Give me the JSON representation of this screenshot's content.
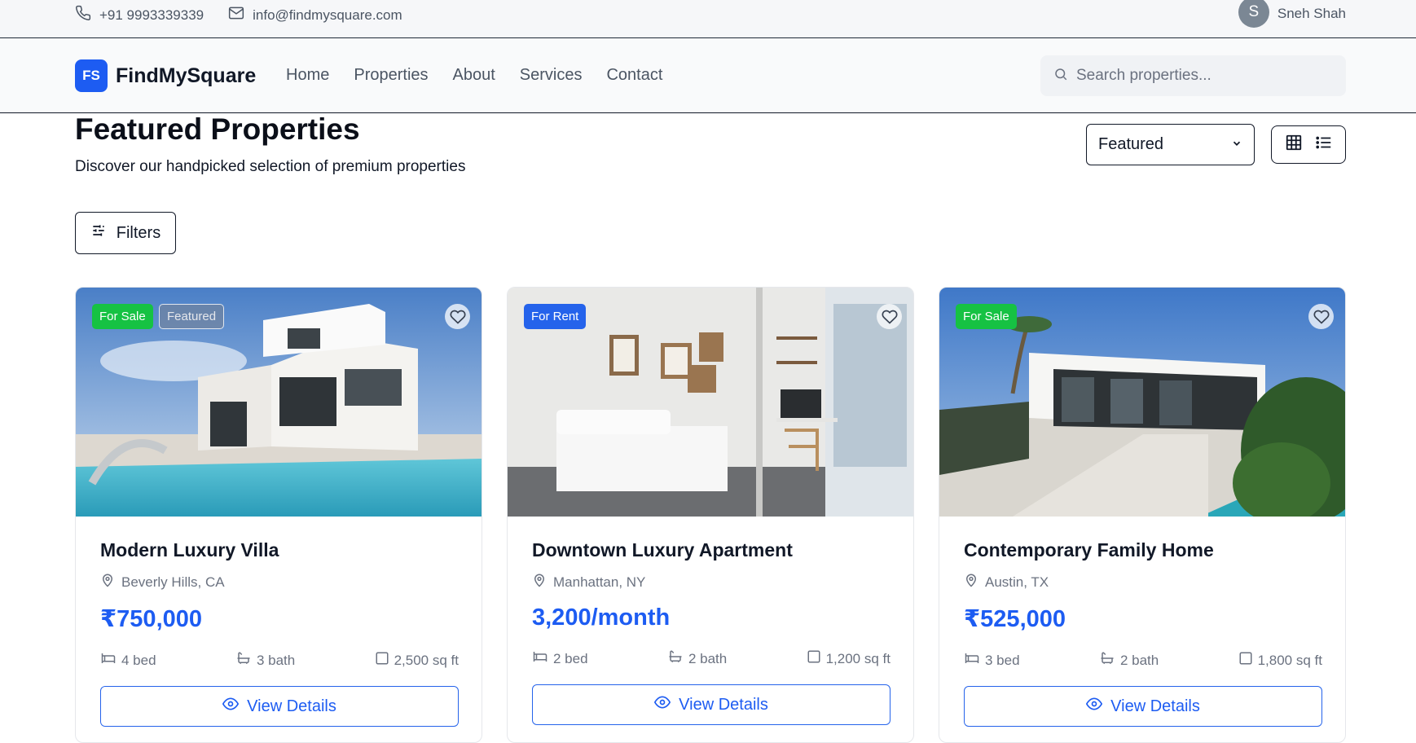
{
  "topbar": {
    "phone": "+91 9993339339",
    "email": "info@findmysquare.com",
    "user_initial": "S",
    "user_name": "Sneh Shah"
  },
  "brand": {
    "logo_text": "FS",
    "name": "FindMySquare"
  },
  "nav": {
    "items": [
      "Home",
      "Properties",
      "About",
      "Services",
      "Contact"
    ]
  },
  "search": {
    "placeholder": "Search properties..."
  },
  "page": {
    "title": "Featured Properties",
    "subtitle": "Discover our handpicked selection of premium properties",
    "sort_value": "Featured",
    "filters_label": "Filters"
  },
  "colors": {
    "accent": "#1d5cf2",
    "sale": "#16c243",
    "rent": "#2563eb"
  },
  "cards": [
    {
      "badges": [
        "For Sale",
        "Featured"
      ],
      "title": "Modern Luxury Villa",
      "location": "Beverly Hills, CA",
      "price": "₹750,000",
      "beds": "4 bed",
      "baths": "3 bath",
      "area": "2,500 sq ft",
      "button": "View Details"
    },
    {
      "badges": [
        "For Rent"
      ],
      "title": "Downtown Luxury Apartment",
      "location": "Manhattan, NY",
      "price": "3,200/month",
      "beds": "2 bed",
      "baths": "2 bath",
      "area": "1,200 sq ft",
      "button": "View Details"
    },
    {
      "badges": [
        "For Sale"
      ],
      "title": "Contemporary Family Home",
      "location": "Austin, TX",
      "price": "₹525,000",
      "beds": "3 bed",
      "baths": "2 bath",
      "area": "1,800 sq ft",
      "button": "View Details"
    }
  ]
}
